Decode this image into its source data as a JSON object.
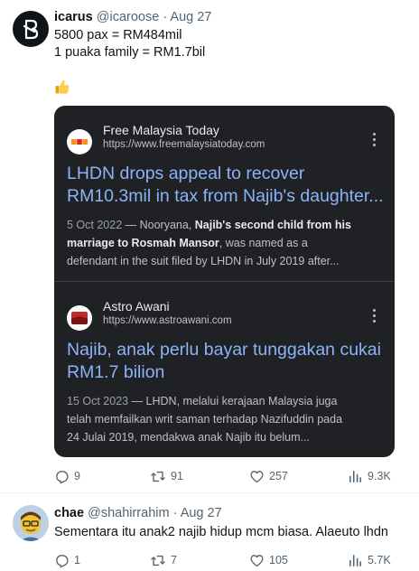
{
  "tweets": [
    {
      "display_name": "icarus",
      "handle": "@icaroose",
      "date": "Aug 27",
      "lines": [
        "5800 pax = RM484mil",
        "1 puaka family = RM1.7bil"
      ],
      "emoji": "thumbs-up",
      "card": {
        "results": [
          {
            "site": "Free Malaysia Today",
            "url": "https://www.freemalaysiatoday.com",
            "title_lines": [
              "LHDN drops appeal to recover",
              "RM10.3mil in tax from Najib's daughter..."
            ],
            "desc": {
              "date": "5 Oct 2022",
              "line1_pre": " — Nooryana, ",
              "line1_bold": "Najib's second child from his",
              "line2_bold": "marriage to Rosmah Mansor",
              "line2_post": ", was named as a",
              "line3": "defendant in the suit filed by LHDN in July 2019 after..."
            }
          },
          {
            "site": "Astro Awani",
            "url": "https://www.astroawani.com",
            "title_lines": [
              "Najib, anak perlu bayar tunggakan cukai",
              "RM1.7 bilion"
            ],
            "desc": {
              "date": "15 Oct 2023",
              "line1": " — LHDN, melalui kerajaan Malaysia juga",
              "line2": "telah memfailkan writ saman terhadap Nazifuddin pada",
              "line3": "24 Julai 2019, mendakwa anak Najib itu belum..."
            }
          }
        ]
      },
      "stats": {
        "replies": "9",
        "reposts": "91",
        "likes": "257",
        "views": "9.3K"
      }
    },
    {
      "display_name": "chae",
      "handle": "@shahirrahim",
      "date": "Aug 27",
      "lines": [
        "Sementara itu anak2 najib hidup mcm biasa. Alaeuto lhdn"
      ],
      "stats": {
        "replies": "1",
        "reposts": "7",
        "likes": "105",
        "views": "5.7K"
      }
    }
  ],
  "separator": "·",
  "colors": {
    "card_bg": "#202124",
    "link_blue": "#8ab4f8",
    "muted_text": "#536471",
    "fmt_orange": "#f7941d",
    "fmt_red": "#e2231a",
    "awani_red": "#c1272d"
  }
}
